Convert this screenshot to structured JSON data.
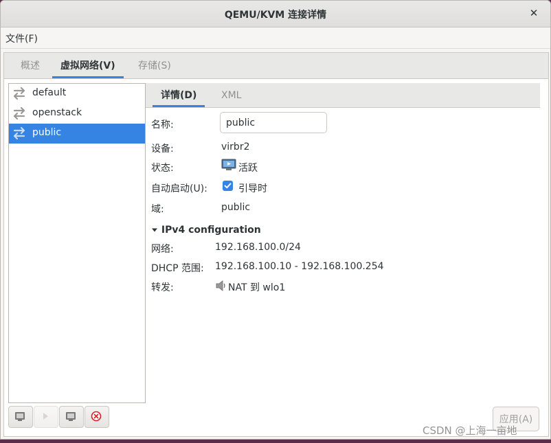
{
  "window": {
    "title": "QEMU/KVM 连接详情",
    "close_glyph": "✕"
  },
  "menubar": {
    "file": "文件(F)"
  },
  "tabs": [
    {
      "label": "概述",
      "active": false
    },
    {
      "label": "虚拟网络(V)",
      "active": true
    },
    {
      "label": "存储(S)",
      "active": false
    }
  ],
  "networks": [
    {
      "label": "default",
      "icon": "network-arrows-icon",
      "selected": false
    },
    {
      "label": "openstack",
      "icon": "network-arrows-icon",
      "selected": false
    },
    {
      "label": "public",
      "icon": "network-arrows-icon",
      "selected": true
    }
  ],
  "toolbar": {
    "buttons": [
      {
        "icon": "add-network-icon",
        "enabled": true
      },
      {
        "icon": "start-icon",
        "enabled": false
      },
      {
        "icon": "stop-icon",
        "enabled": true
      },
      {
        "icon": "delete-icon",
        "enabled": true
      }
    ]
  },
  "subtabs": [
    {
      "label": "详情(D)",
      "active": true
    },
    {
      "label": "XML",
      "active": false
    }
  ],
  "details": {
    "name_label": "名称:",
    "name_value": "public",
    "device_label": "设备:",
    "device_value": "virbr2",
    "state_label": "状态:",
    "state_value": "活跃",
    "state_icon": "monitor-icon",
    "autostart_label": "自动启动(U):",
    "autostart_value": "引导时",
    "autostart_checked": true,
    "domain_label": "域:",
    "domain_value": "public"
  },
  "ipv4": {
    "header": "IPv4 configuration",
    "expanded": true,
    "network_label": "网络:",
    "network_value": "192.168.100.0/24",
    "dhcp_label": "DHCP 范围:",
    "dhcp_value": "192.168.100.10 - 192.168.100.254",
    "forward_label": "转发:",
    "forward_value": "NAT 到 wlo1",
    "forward_icon": "speaker-icon"
  },
  "apply_button": "应用(A)",
  "watermark": "CSDN @上海一亩地",
  "colors": {
    "accent": "#3584e4",
    "delete": "#e01b24"
  }
}
